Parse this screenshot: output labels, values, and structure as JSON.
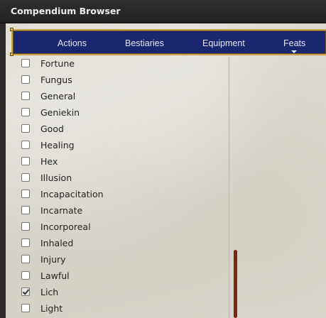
{
  "window": {
    "title": "Compendium Browser"
  },
  "tabs": [
    {
      "label": "Actions"
    },
    {
      "label": "Bestiaries"
    },
    {
      "label": "Equipment"
    },
    {
      "label": "Feats",
      "icon": "caret-down-icon"
    }
  ],
  "traits": [
    {
      "label": "Fortune",
      "checked": false
    },
    {
      "label": "Fungus",
      "checked": false
    },
    {
      "label": "General",
      "checked": false
    },
    {
      "label": "Geniekin",
      "checked": false
    },
    {
      "label": "Good",
      "checked": false
    },
    {
      "label": "Healing",
      "checked": false
    },
    {
      "label": "Hex",
      "checked": false
    },
    {
      "label": "Illusion",
      "checked": false
    },
    {
      "label": "Incapacitation",
      "checked": false
    },
    {
      "label": "Incarnate",
      "checked": false
    },
    {
      "label": "Incorporeal",
      "checked": false
    },
    {
      "label": "Inhaled",
      "checked": false
    },
    {
      "label": "Injury",
      "checked": false
    },
    {
      "label": "Lawful",
      "checked": false
    },
    {
      "label": "Lich",
      "checked": true
    },
    {
      "label": "Light",
      "checked": false
    }
  ],
  "colors": {
    "navbar": "#1b2670",
    "navbar_border": "#c9a24a",
    "scroll_thumb": "#7a2a13"
  }
}
